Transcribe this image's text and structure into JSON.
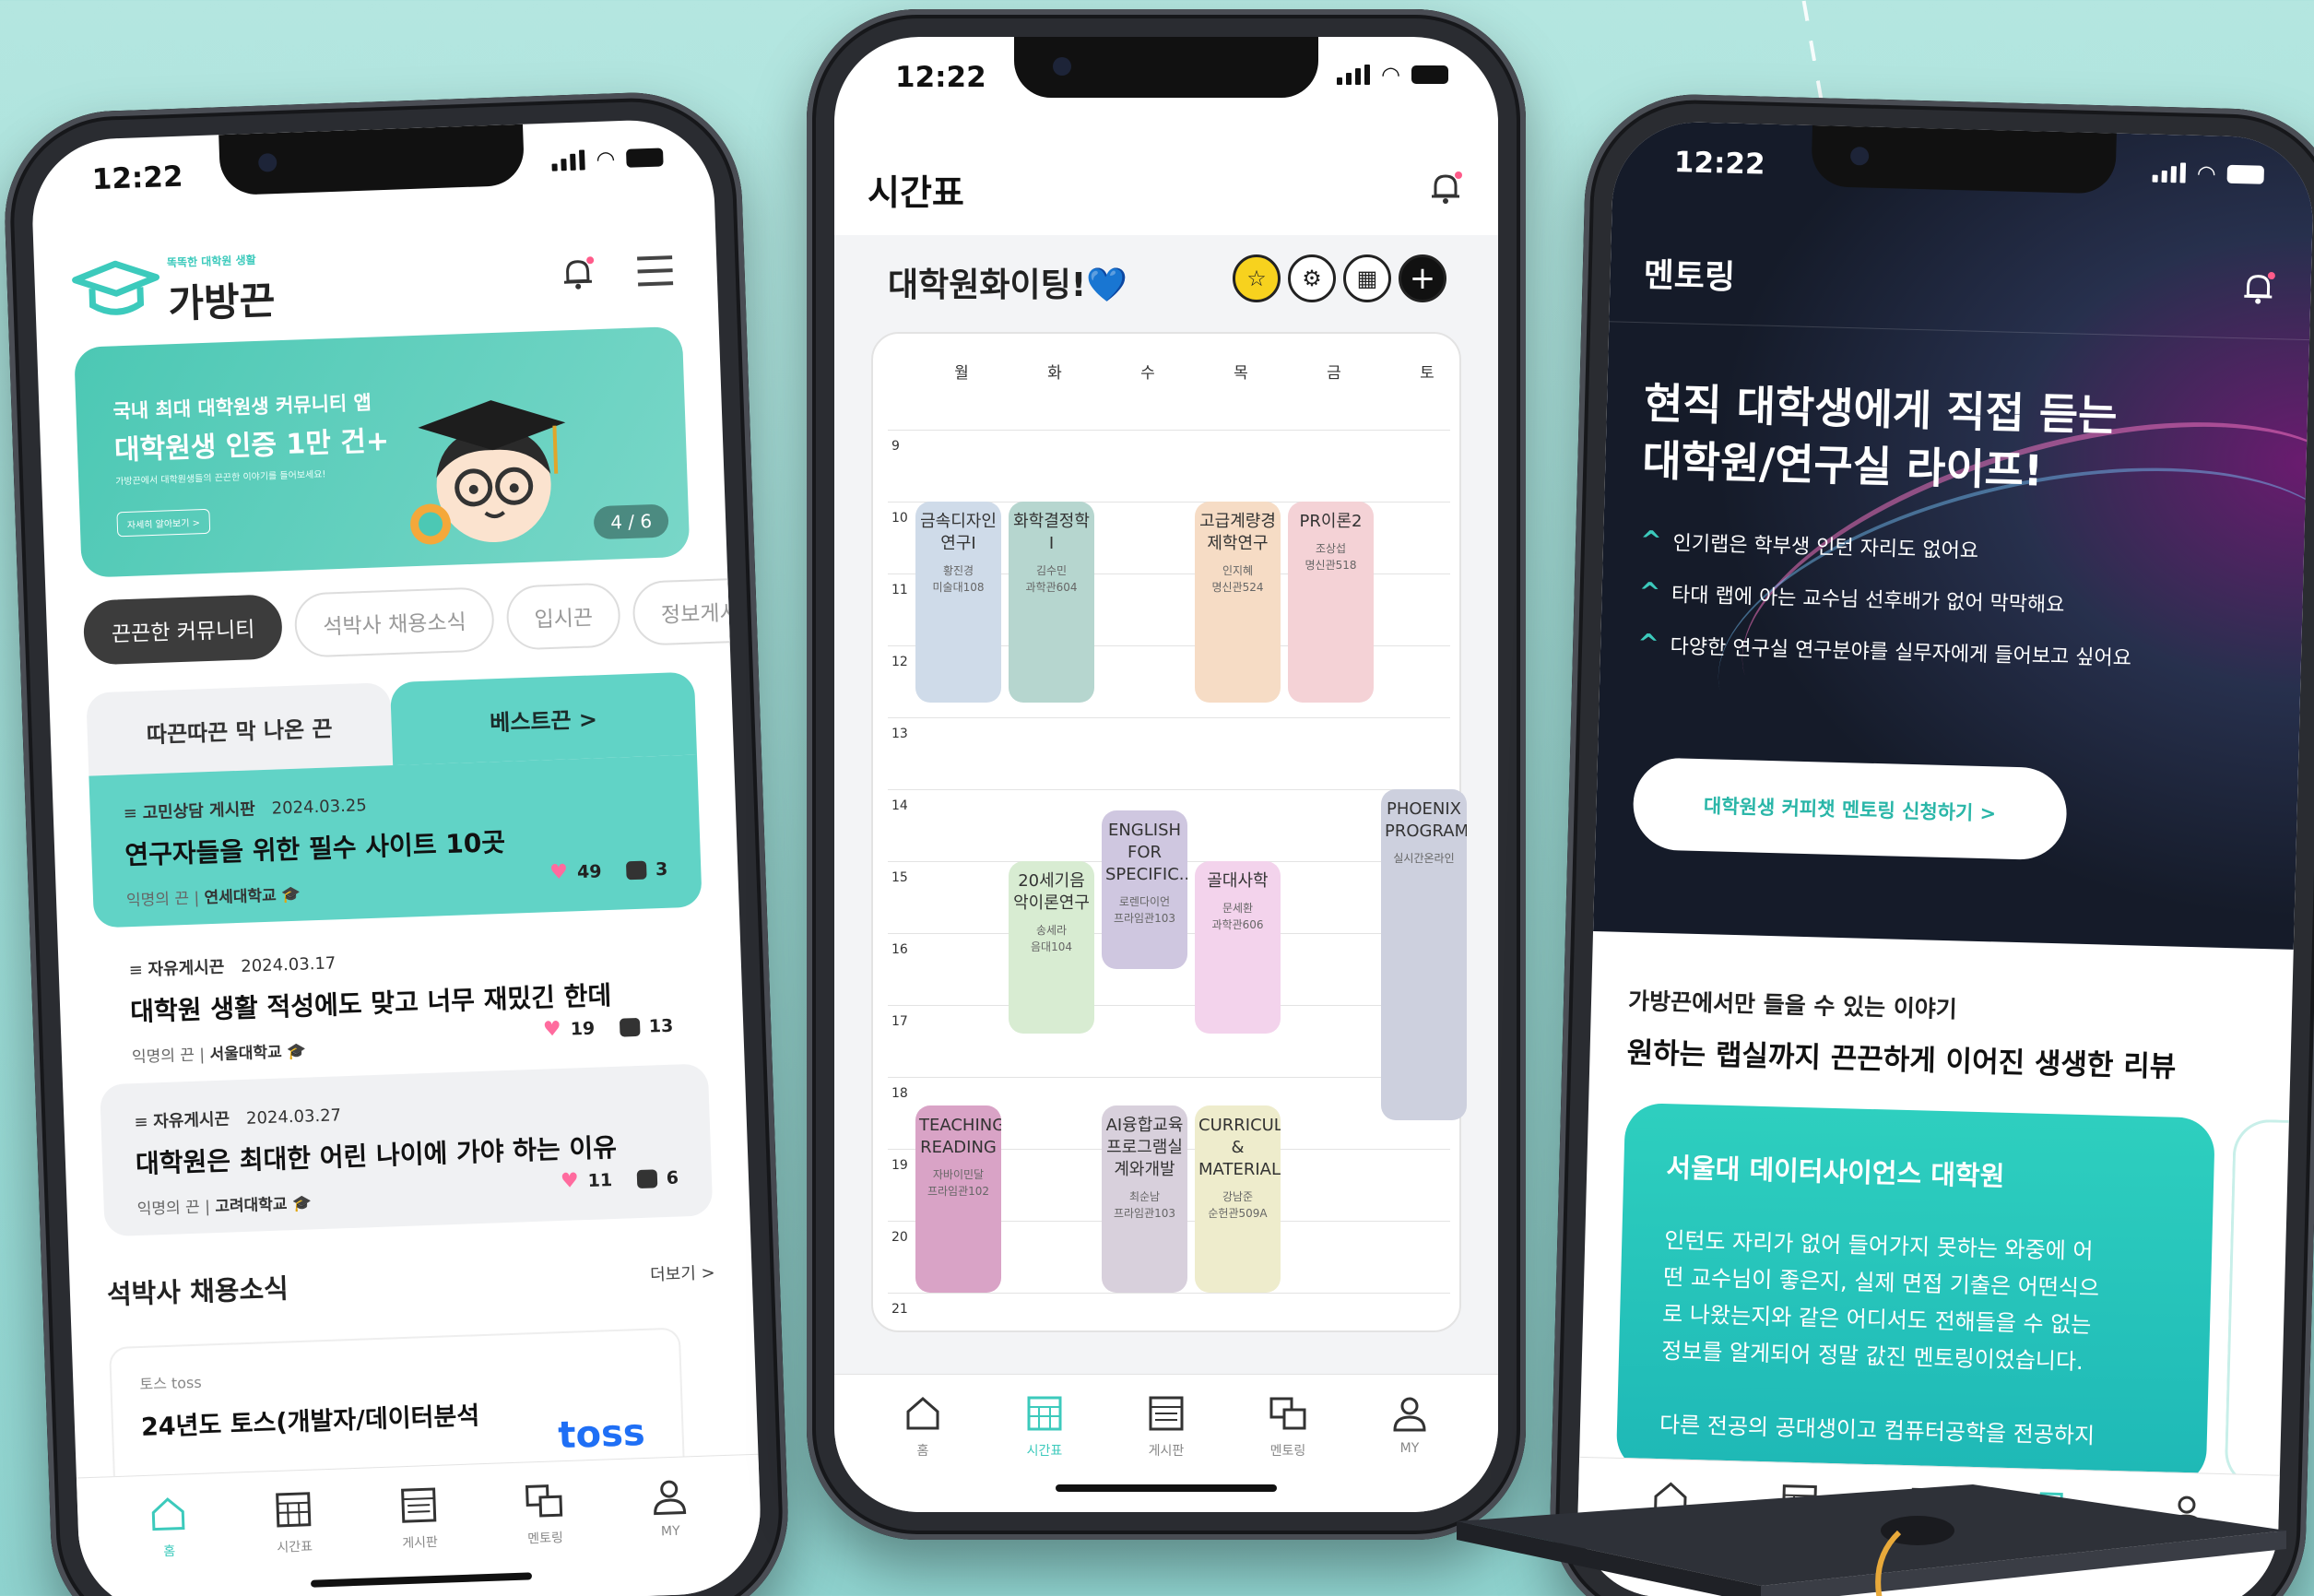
{
  "status": {
    "time": "12:22"
  },
  "nav": {
    "home": "홈",
    "timetable": "시간표",
    "board": "게시판",
    "mentoring": "멘토링",
    "my": "MY"
  },
  "phone1": {
    "logo_tagline": "똑똑한 대학원 생활",
    "logo_name": "가방끈",
    "banner": {
      "line1": "국내 최대 대학원생 커뮤니티 앱",
      "line2": "대학원생 인증 1만 건+",
      "line3": "가방끈에서 대학원생들의 끈끈한 이야기를 들어보세요!",
      "button": "자세히 알아보기 >",
      "pager": "4 / 6"
    },
    "chips": [
      "끈끈한 커뮤니티",
      "석박사 채용소식",
      "입시끈",
      "정보게시"
    ],
    "feed_tabs": {
      "left": "따끈따끈 막 나온 끈",
      "right": "베스트끈  >"
    },
    "posts": [
      {
        "board": "고민상담 게시판",
        "date": "2024.03.25",
        "title": "연구자들을 위한 필수 사이트 10곳",
        "author": "익명의 끈",
        "school": "연세대학교",
        "likes": "49",
        "comments": "3"
      },
      {
        "board": "자유게시끈",
        "date": "2024.03.17",
        "title": "대학원 생활 적성에도 맞고 너무 재밌긴 한데",
        "author": "익명의 끈",
        "school": "서울대학교",
        "likes": "19",
        "comments": "13"
      },
      {
        "board": "자유게시끈",
        "date": "2024.03.27",
        "title": "대학원은 최대한 어린 나이에 가야 하는 이유",
        "author": "익명의 끈",
        "school": "고려대학교",
        "likes": "11",
        "comments": "6"
      }
    ],
    "section_title": "석박사 채용소식",
    "section_more": "더보기 >",
    "job": {
      "company": "토스 toss",
      "title": "24년도 토스(개발자/데이터분석",
      "logo": "toss"
    }
  },
  "phone2": {
    "title": "시간표",
    "timetable_name": "대학원화이팅!💙",
    "days": [
      "월",
      "화",
      "수",
      "목",
      "금",
      "토"
    ],
    "hours": [
      "9",
      "10",
      "11",
      "12",
      "13",
      "14",
      "15",
      "16",
      "17",
      "18",
      "19",
      "20",
      "21"
    ],
    "classes": [
      {
        "name": "금속디자인연구I",
        "prof": "황진경",
        "room": "미술대108",
        "day": 0,
        "start": 10,
        "end": 12.8,
        "color": "#cfdbe9"
      },
      {
        "name": "화학결정학I",
        "prof": "김수민",
        "room": "과학관604",
        "day": 1,
        "start": 10,
        "end": 12.8,
        "color": "#b6d6cf"
      },
      {
        "name": "고급계량경제학연구",
        "prof": "인지혜",
        "room": "명신관524",
        "day": 3,
        "start": 10,
        "end": 12.8,
        "color": "#f6dcc5"
      },
      {
        "name": "PR이론2",
        "prof": "조상섭",
        "room": "명신관518",
        "day": 4,
        "start": 10,
        "end": 12.8,
        "color": "#f4d2d6"
      },
      {
        "name": "ENGLISH FOR SPECIFIC...",
        "prof": "로렌다이언",
        "room": "프라임관103",
        "day": 2,
        "start": 14.3,
        "end": 16.5,
        "color": "#cfc7e0"
      },
      {
        "name": "20세기음악이론연구",
        "prof": "송세라",
        "room": "음대104",
        "day": 1,
        "start": 15,
        "end": 17.4,
        "color": "#d8ecd2"
      },
      {
        "name": "골대사학",
        "prof": "문세환",
        "room": "과학관606",
        "day": 3,
        "start": 15,
        "end": 17.4,
        "color": "#f3d3ec"
      },
      {
        "name": "PHOENIX PROGRAM",
        "prof": "",
        "room": "실시간온라인",
        "day": 5,
        "start": 14,
        "end": 18.6,
        "color": "#cdd0de"
      },
      {
        "name": "TEACHING READING",
        "prof": "자바이민달",
        "room": "프라임관102",
        "day": 0,
        "start": 18.4,
        "end": 21,
        "color": "#d9a3c6"
      },
      {
        "name": "AI융합교육프로그램실계와개발",
        "prof": "최순남",
        "room": "프라임관103",
        "day": 2,
        "start": 18.4,
        "end": 21,
        "color": "#d8d0dc"
      },
      {
        "name": "CURRICULA & MATERIALS...",
        "prof": "강남준",
        "room": "순헌관509A",
        "day": 3,
        "start": 18.4,
        "end": 21,
        "color": "#eeeccc"
      }
    ]
  },
  "phone3": {
    "title": "멘토링",
    "hero_title_line1": "현직 대학생에게 직접 듣는",
    "hero_title_line2": "대학원/연구실 라이프!",
    "bullets": [
      "인기랩은 학부생 인턴 자리도 없어요",
      "타대 랩에 아는 교수님 선후배가 없어 막막해요",
      "다양한 연구실 연구분야를 실무자에게 들어보고 싶어요"
    ],
    "cta": "대학원생 커피챗 멘토링 신청하기  >",
    "sub1": "가방끈에서만 들을 수 있는 이야기",
    "sub2": "원하는 랩실까지 끈끈하게 이어진 생생한 리뷰",
    "review": {
      "title": "서울대 데이터사이언스 대학원",
      "body_line1": "인턴도 자리가 없어 들어가지 못하는 와중에 어",
      "body_line2": "떤 교수님이 좋은지, 실제 면접 기출은 어떤식으",
      "body_line3": "로 나왔는지와 같은 어디서도 전해들을 수 없는",
      "body_line4": "정보를 알게되어 정말 값진 멘토링이었습니다.",
      "body_more": "다른 전공의 공대생이고 컴퓨터공학을 전공하지"
    }
  },
  "colors": {
    "accent": "#3ccabc",
    "heart": "#ff6b9e"
  }
}
